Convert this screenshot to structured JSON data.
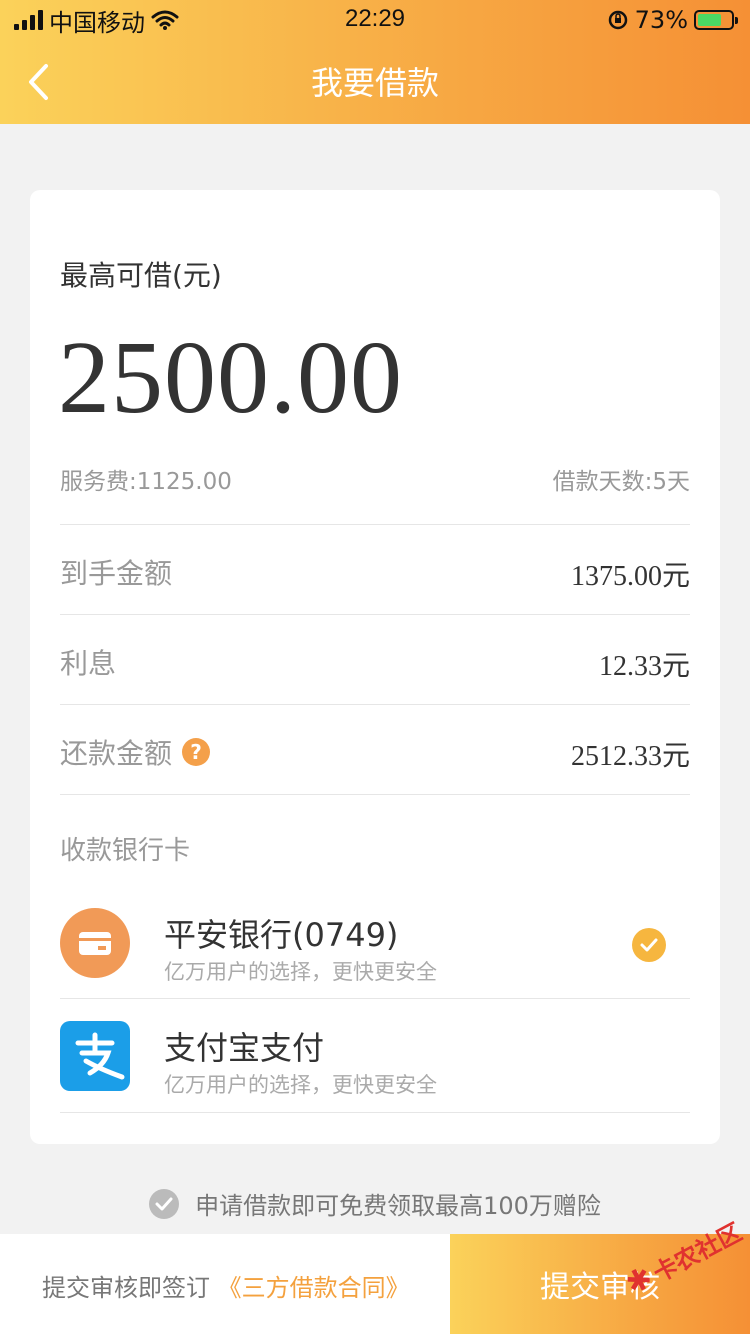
{
  "status_bar": {
    "carrier": "中国移动",
    "time": "22:29",
    "battery_percent": "73%",
    "battery_level": 0.73,
    "icons": [
      "signal-icon",
      "wifi-icon",
      "rotation-lock-icon",
      "battery-icon"
    ]
  },
  "nav": {
    "title": "我要借款",
    "back_icon": "chevron-left-icon"
  },
  "loan": {
    "max_label": "最高可借(元)",
    "max_amount": "2500.00",
    "service_fee": "服务费:1125.00",
    "loan_days": "借款天数:5天",
    "rows": [
      {
        "label": "到手金额",
        "value": "1375.00元"
      },
      {
        "label": "利息",
        "value": "12.33元"
      },
      {
        "label": "还款金额",
        "value": "2512.33元",
        "help_icon": "question-icon"
      }
    ]
  },
  "bank": {
    "section_label": "收款银行卡",
    "items": [
      {
        "name": "平安银行(0749)",
        "desc": "亿万用户的选择，更快更安全",
        "icon": "bank-card-icon",
        "selected": true
      },
      {
        "name": "支付宝支付",
        "desc": "亿万用户的选择，更快更安全",
        "icon": "alipay-icon",
        "selected": false
      }
    ]
  },
  "notice": {
    "text": "申请借款即可免费领取最高100万赠险"
  },
  "footer": {
    "agree_prefix": "提交审核即签订",
    "agree_link": "《三方借款合同》",
    "submit_label": "提交审核"
  },
  "watermark": {
    "text": "卡农社区"
  },
  "colors": {
    "accent_start": "#fbd25a",
    "accent_end": "#f59035",
    "link": "#f4a13e",
    "check": "#f6b63f"
  }
}
